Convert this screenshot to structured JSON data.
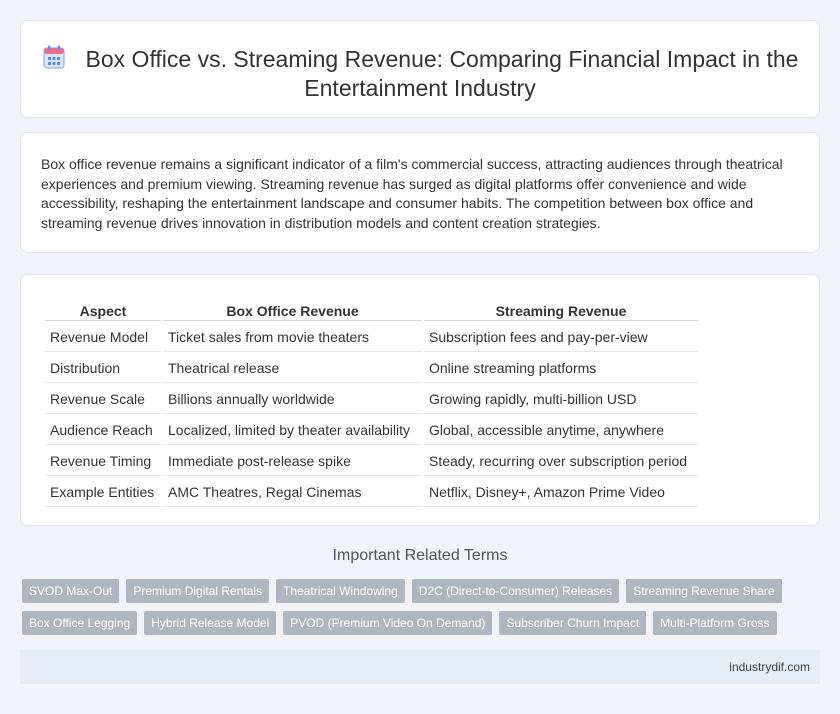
{
  "header": {
    "icon": "calendar-icon",
    "title": "Box Office vs. Streaming Revenue: Comparing Financial Impact in the Entertainment Industry"
  },
  "intro": {
    "text": "Box office revenue remains a significant indicator of a film's commercial success, attracting audiences through theatrical experiences and premium viewing. Streaming revenue has surged as digital platforms offer convenience and wide accessibility, reshaping the entertainment landscape and consumer habits. The competition between box office and streaming revenue drives innovation in distribution models and content creation strategies."
  },
  "table": {
    "headers": [
      "Aspect",
      "Box Office Revenue",
      "Streaming Revenue"
    ],
    "rows": [
      [
        "Revenue Model",
        "Ticket sales from movie theaters",
        "Subscription fees and pay-per-view"
      ],
      [
        "Distribution",
        "Theatrical release",
        "Online streaming platforms"
      ],
      [
        "Revenue Scale",
        "Billions annually worldwide",
        "Growing rapidly, multi-billion USD"
      ],
      [
        "Audience Reach",
        "Localized, limited by theater availability",
        "Global, accessible anytime, anywhere"
      ],
      [
        "Revenue Timing",
        "Immediate post-release spike",
        "Steady, recurring over subscription period"
      ],
      [
        "Example Entities",
        "AMC Theatres, Regal Cinemas",
        "Netflix, Disney+, Amazon Prime Video"
      ]
    ]
  },
  "terms": {
    "heading": "Important Related Terms",
    "row1": [
      "SVOD Max-Out",
      "Premium Digital Rentals",
      "Theatrical Windowing",
      "D2C (Direct-to-Consumer) Releases",
      "Streaming Revenue Share"
    ],
    "row2": [
      "Box Office Legging",
      "Hybrid Release Model",
      "PVOD (Premium Video On Demand)",
      "Subscriber Churn Impact",
      "Multi-Platform Gross"
    ]
  },
  "footer": {
    "site": "industrydif.com"
  },
  "colors": {
    "background": "#f1f3f9",
    "tag": "#b0b6c1",
    "footer": "#e6ebf6",
    "icon_accent": "#5b8def",
    "icon_top": "#f06a8a"
  }
}
